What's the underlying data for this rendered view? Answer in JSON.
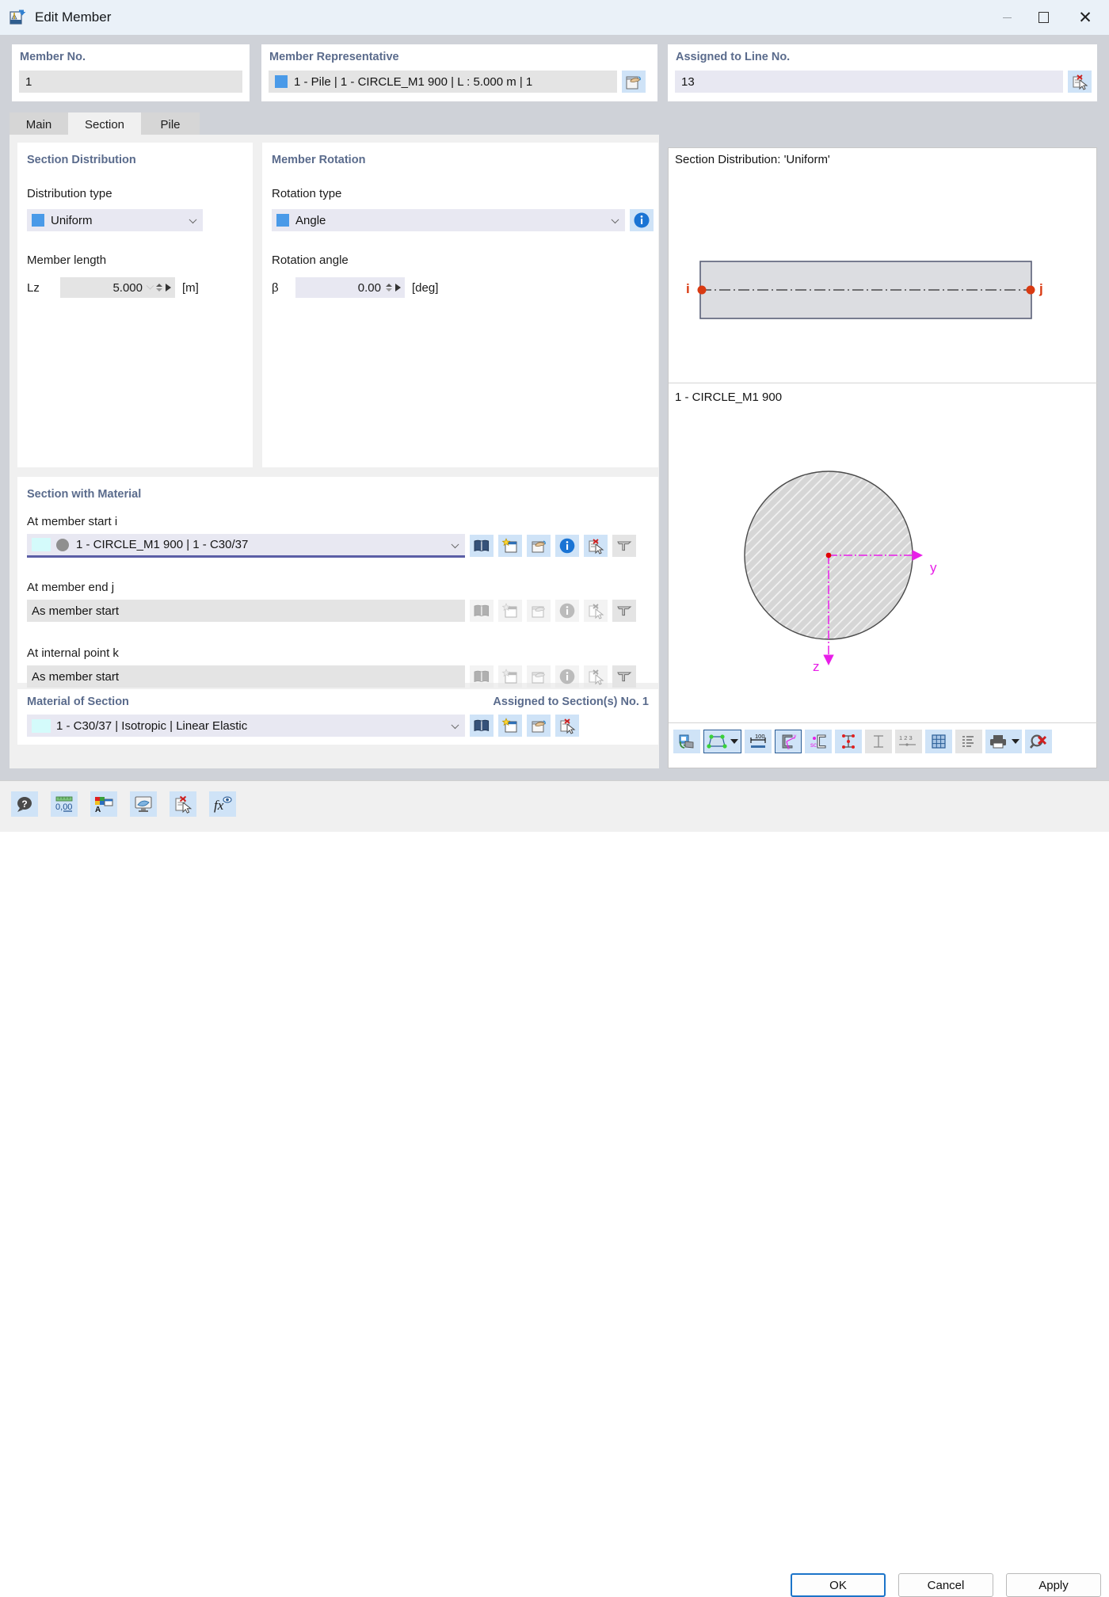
{
  "window": {
    "title": "Edit Member",
    "app_icon": "member-icon",
    "controls": {
      "minimize": "–",
      "maximize": "▢",
      "close": "✕"
    }
  },
  "top": {
    "member_no": {
      "label": "Member No.",
      "value": "1"
    },
    "member_representative": {
      "label": "Member Representative",
      "value": "1 - Pile | 1 - CIRCLE_M1 900 | L : 5.000 m | 1",
      "pick_icon": "pick-from-model-icon"
    },
    "assigned_to_line_no": {
      "label": "Assigned to Line No.",
      "value": "13",
      "clear_icon": "delete-selection-icon"
    }
  },
  "tabs": [
    {
      "label": "Main",
      "active": false
    },
    {
      "label": "Section",
      "active": true
    },
    {
      "label": "Pile",
      "active": false
    }
  ],
  "section_distribution": {
    "title": "Section Distribution",
    "distribution_type_label": "Distribution type",
    "distribution_type_value": "Uniform",
    "member_length_label": "Member length",
    "length_symbol": "Lz",
    "length_value": "5.000",
    "length_unit": "[m]"
  },
  "member_rotation": {
    "title": "Member Rotation",
    "rotation_type_label": "Rotation type",
    "rotation_type_value": "Angle",
    "info_icon": "info-icon",
    "rotation_angle_label": "Rotation angle",
    "angle_symbol": "β",
    "angle_value": "0.00",
    "angle_unit": "[deg]"
  },
  "section_with_material": {
    "title": "Section with Material",
    "rows": [
      {
        "label": "At member start i",
        "value": "1 - CIRCLE_M1 900 | 1 - C30/37",
        "enabled": true
      },
      {
        "label": "At member end j",
        "value": "As member start",
        "enabled": false
      },
      {
        "label": "At internal point k",
        "value": "As member start",
        "enabled": false
      }
    ],
    "row_icons": [
      "library-icon",
      "new-section-icon",
      "edit-section-icon",
      "info-icon",
      "delete-section-icon",
      "section-tool-icon"
    ]
  },
  "material_of_section": {
    "title": "Material of Section",
    "assigned_label": "Assigned to Section(s) No. 1",
    "value": "1 - C30/37 | Isotropic | Linear Elastic",
    "icons": [
      "library-icon",
      "new-material-icon",
      "edit-material-icon",
      "delete-material-icon"
    ]
  },
  "preview": {
    "distribution_caption": "Section Distribution: 'Uniform'",
    "node_i": "i",
    "node_j": "j",
    "section_caption": "1 - CIRCLE_M1 900",
    "axis_y": "y",
    "axis_z": "z",
    "toolbar": [
      {
        "name": "rotate-view-icon",
        "active": true,
        "dropdown": false
      },
      {
        "name": "render-shape-icon",
        "active": true,
        "dropdown": true
      },
      {
        "name": "dimensions-icon",
        "active": true,
        "dropdown": false
      },
      {
        "name": "axis-system-icon",
        "active": true,
        "dropdown": false,
        "selected": true
      },
      {
        "name": "shear-center-icon",
        "active": true,
        "dropdown": false
      },
      {
        "name": "stress-points-icon",
        "active": true,
        "dropdown": false
      },
      {
        "name": "centroid-icon",
        "active": false,
        "dropdown": false
      },
      {
        "name": "part-numbers-icon",
        "active": false,
        "dropdown": false
      },
      {
        "name": "fe-mesh-icon",
        "active": true,
        "dropdown": false
      },
      {
        "name": "list-icon",
        "active": false,
        "dropdown": false
      },
      {
        "name": "print-icon",
        "active": true,
        "dropdown": true
      },
      {
        "name": "zoom-reset-icon",
        "active": true,
        "dropdown": false
      }
    ]
  },
  "footer": {
    "tools": [
      "help-icon",
      "units-icon",
      "display-properties-icon",
      "view-mode-icon",
      "delete-icon",
      "formula-icon"
    ],
    "ok_label": "OK",
    "cancel_label": "Cancel",
    "apply_label": "Apply"
  },
  "colors": {
    "accent_blue": "#4a9ae8",
    "title_text": "#5a6b8c",
    "selected_underline": "#5b5ea6",
    "node_red": "#d93a12",
    "axis_magenta": "#e81ee8",
    "ok_border": "#1c74c9"
  }
}
